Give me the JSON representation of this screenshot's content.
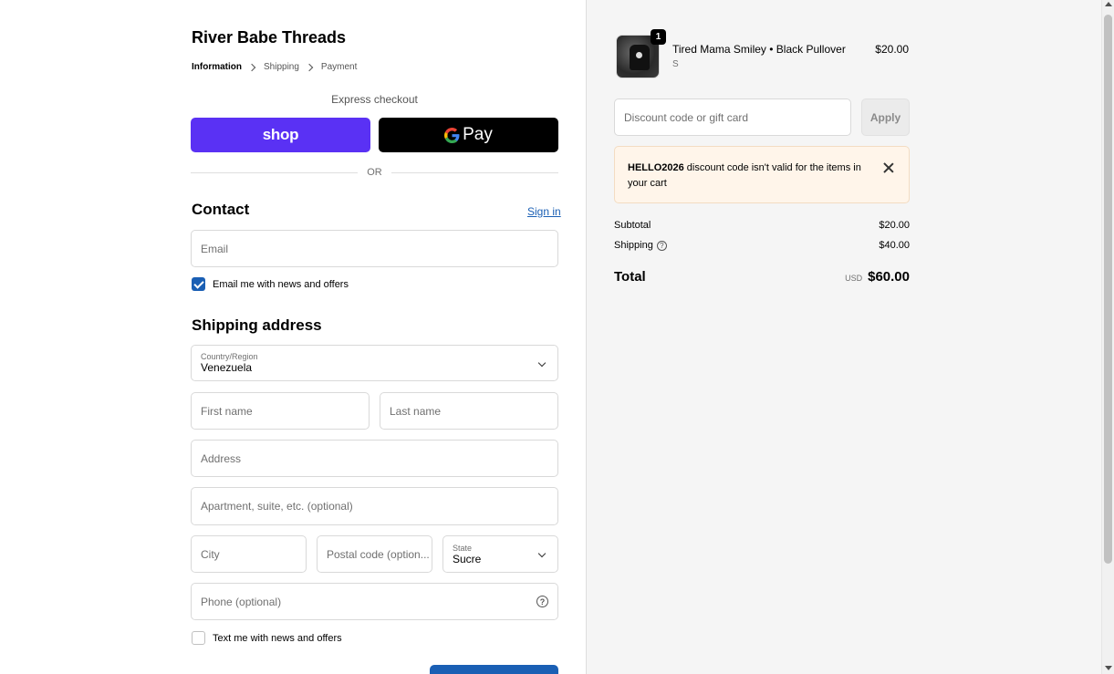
{
  "store": {
    "name": "River Babe Threads"
  },
  "breadcrumb": [
    "Information",
    "Shipping",
    "Payment"
  ],
  "express": {
    "label": "Express checkout",
    "shop_label": "shop",
    "gpay_label": "Pay"
  },
  "divider": "OR",
  "contact": {
    "title": "Contact",
    "sign_in": "Sign in",
    "email_placeholder": "Email",
    "newsletter_label": "Email me with news and offers",
    "newsletter_checked": true
  },
  "shipping": {
    "title": "Shipping address",
    "country_label": "Country/Region",
    "country_value": "Venezuela",
    "first_name": "First name",
    "last_name": "Last name",
    "address": "Address",
    "apartment": "Apartment, suite, etc. (optional)",
    "city": "City",
    "postal": "Postal code (option...",
    "state_label": "State",
    "state_value": "Sucre",
    "phone": "Phone (optional)",
    "sms_label": "Text me with news and offers",
    "sms_checked": false
  },
  "cart": {
    "item": {
      "title": "Tired Mama Smiley • Black Pullover",
      "variant": "S",
      "price": "$20.00",
      "quantity": "1"
    },
    "discount_placeholder": "Discount code or gift card",
    "apply_label": "Apply",
    "notice": {
      "code": "HELLO2026",
      "message": " discount code isn't valid for the items in your cart"
    },
    "subtotal_label": "Subtotal",
    "subtotal_value": "$20.00",
    "shipping_label": "Shipping",
    "shipping_value": "$40.00",
    "total_label": "Total",
    "currency": "USD",
    "total_value": "$60.00"
  },
  "colors": {
    "shop_purple": "#5a31f4",
    "link_blue": "#1a5fb4",
    "notice_bg": "#fff5ea"
  }
}
